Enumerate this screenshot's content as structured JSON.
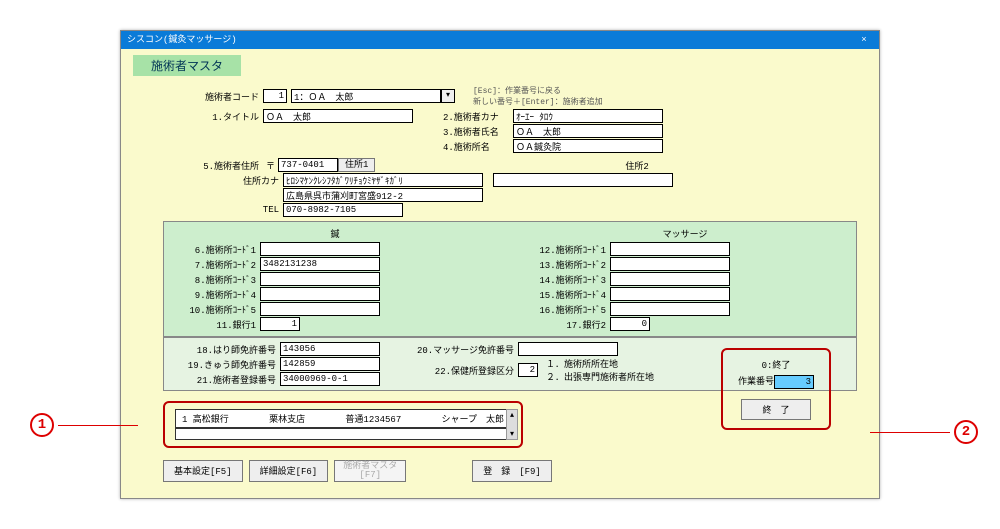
{
  "window": {
    "title": "シスコン(鍼灸マッサージ)"
  },
  "heading": "施術者マスタ",
  "hints": {
    "esc": "[Esc]：作業番号に戻る",
    "enter": "新しい番号＋[Enter]：施術者追加"
  },
  "fields": {
    "code_label": "施術者コード",
    "code_value": "1",
    "code_select": "1：ＯＡ　太郎",
    "title_label": "1.タイトル",
    "title_value": "ＯＡ　太郎",
    "kana_label": "2.施術者カナ",
    "kana_value": "ｵｰｴｰ ﾀﾛｳ",
    "name_label": "3.施術者氏名",
    "name_value": "ＯＡ　太郎",
    "shop_label": "4.施術所名",
    "shop_value": "ＯＡ鍼灸院",
    "addr_label": "5.施術者住所",
    "postal_mark": "〒",
    "postal_value": "737-0401",
    "addr1_btn": "住所1",
    "addr2_label": "住所2",
    "addr_kana_label": "住所カナ",
    "addr_kana_value": "ﾋﾛｼﾏｹﾝｸﾚｼﾌﾀｶﾞﾜﾘﾁｮｳﾐﾔｻﾞｷｶﾞﾘ",
    "addr_value": "広島県呉市蒲刈町宮盛912-2",
    "tel_label": "TEL",
    "tel_value": "070-8982-7105"
  },
  "codes": {
    "left_title": "鍼",
    "right_title": "マッサージ",
    "left": [
      {
        "label": "6.施術所ｺｰﾄﾞ1",
        "value": ""
      },
      {
        "label": "7.施術所ｺｰﾄﾞ2",
        "value": "3482131238"
      },
      {
        "label": "8.施術所ｺｰﾄﾞ3",
        "value": ""
      },
      {
        "label": "9.施術所ｺｰﾄﾞ4",
        "value": ""
      },
      {
        "label": "10.施術所ｺｰﾄﾞ5",
        "value": ""
      },
      {
        "label": "11.銀行1",
        "value": "1"
      }
    ],
    "right": [
      {
        "label": "12.施術所ｺｰﾄﾞ1",
        "value": ""
      },
      {
        "label": "13.施術所ｺｰﾄﾞ2",
        "value": ""
      },
      {
        "label": "14.施術所ｺｰﾄﾞ3",
        "value": ""
      },
      {
        "label": "15.施術所ｺｰﾄﾞ4",
        "value": ""
      },
      {
        "label": "16.施術所ｺｰﾄﾞ5",
        "value": ""
      },
      {
        "label": "17.銀行2",
        "value": "0"
      }
    ]
  },
  "licenses": {
    "l18": {
      "label": "18.はり師免許番号",
      "value": "143056"
    },
    "l19": {
      "label": "19.きゅう師免許番号",
      "value": "142859"
    },
    "l21": {
      "label": "21.施術者登録番号",
      "value": "34000969-0-1"
    },
    "l20": {
      "label": "20.マッサージ免許番号",
      "value": ""
    },
    "l22": {
      "label": "22.保健所登録区分",
      "value": "2"
    },
    "l22_opt1": "１．施術所所在地",
    "l22_opt2": "２．出張専門施術者所在地"
  },
  "list": {
    "bank": "1 高松銀行",
    "branch": "栗林支店",
    "account": "普通1234567",
    "holder": "シャープ　太郎"
  },
  "right_panel": {
    "top": "0:終了",
    "label": "作業番号",
    "value": "3",
    "exit": "終　了"
  },
  "buttons": {
    "f5": "基本設定[F5]",
    "f6": "詳細設定[F6]",
    "f7": "施術者マスタ\n[F7]",
    "f9": "登　録　[F9]"
  },
  "callouts": {
    "c1": "1",
    "c2": "2"
  }
}
